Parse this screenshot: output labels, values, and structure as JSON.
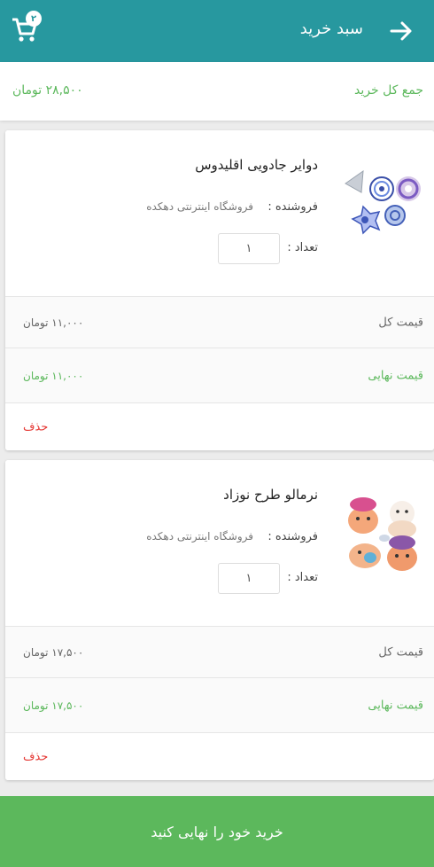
{
  "header": {
    "title": "سبد خرید",
    "cart_badge": "۲",
    "back_icon": "arrow-right-icon",
    "cart_icon": "shopping-cart-icon"
  },
  "total": {
    "label": "جمع کل خرید",
    "value": "۲۸,۵۰۰  تومان"
  },
  "items": [
    {
      "title": "دوایر جادویی اقلیدوس",
      "seller_label": "فروشنده :",
      "seller": "فروشگاه اینترنتی دهکده",
      "qty_label": "تعداد :",
      "qty": "۱",
      "sum_label": "قیمت کل",
      "sum_value": "۱۱,۰۰۰  تومان",
      "final_label": "قیمت نهایی",
      "final_value": "۱۱,۰۰۰  تومان",
      "delete": "حذف",
      "image": "spirograph-image"
    },
    {
      "title": "نرمالو طرح نوزاد",
      "seller_label": "فروشنده :",
      "seller": "فروشگاه اینترنتی دهکده",
      "qty_label": "تعداد :",
      "qty": "۱",
      "sum_label": "قیمت کل",
      "sum_value": "۱۷,۵۰۰  تومان",
      "final_label": "قیمت نهایی",
      "final_value": "۱۷,۵۰۰  تومان",
      "delete": "حذف",
      "image": "baby-toys-image"
    }
  ],
  "checkout": {
    "label": "خرید خود را نهایی کنید"
  },
  "colors": {
    "header": "#27989f",
    "accent_green": "#5cb85c",
    "delete_red": "#e53935",
    "background": "#ececec"
  }
}
